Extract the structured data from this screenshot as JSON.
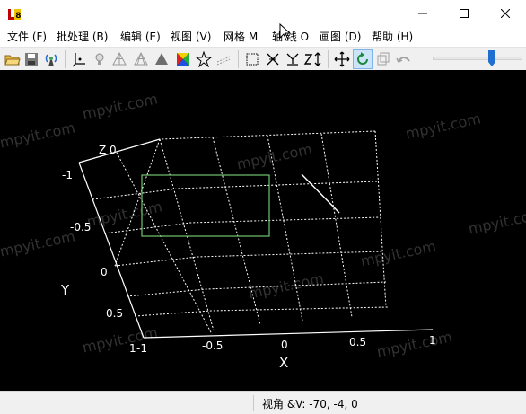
{
  "window": {
    "app_icon": "app-logo-icon",
    "controls": [
      "minimize-icon",
      "maximize-icon",
      "close-icon"
    ]
  },
  "menu": {
    "items": [
      {
        "label": "文件 (F)"
      },
      {
        "label": "批处理 (B)"
      },
      {
        "label": "编辑 (E)"
      },
      {
        "label": "视图 (V)"
      },
      {
        "label": "网格 M"
      },
      {
        "label": "轴 线 O"
      },
      {
        "label": "画图 (D)"
      },
      {
        "label": "帮助 (H)"
      }
    ]
  },
  "toolbar": {
    "icons": [
      "open-folder-icon",
      "save-icon",
      "broadcast-icon",
      "axes-icon",
      "light-icon",
      "wireframe-icon",
      "mesh-icon",
      "solid-icon",
      "colormap-icon",
      "star-icon",
      "contour-icon",
      "box-icon",
      "x-axis-icon",
      "y-axis-icon",
      "z-axis-icon",
      "move-icon",
      "rotate-icon",
      "copy-icon",
      "undo-icon"
    ],
    "rotate_active": true,
    "slider_level": 0.66
  },
  "plot": {
    "z_label": "Z 0",
    "x_ticks": [
      "-1",
      "-0.5",
      "0",
      "0.5",
      "1"
    ],
    "y_ticks": [
      "-1",
      "-0.5",
      "0",
      "0.5",
      "1"
    ],
    "x_title": "X",
    "y_title": "Y",
    "watermark": "mpyit.com",
    "grid_color": "#ffffff",
    "rect_color": "#6fc46f",
    "line_color": "#ffffff"
  },
  "status": {
    "text": "视角 &V: -70, -4, 0"
  }
}
